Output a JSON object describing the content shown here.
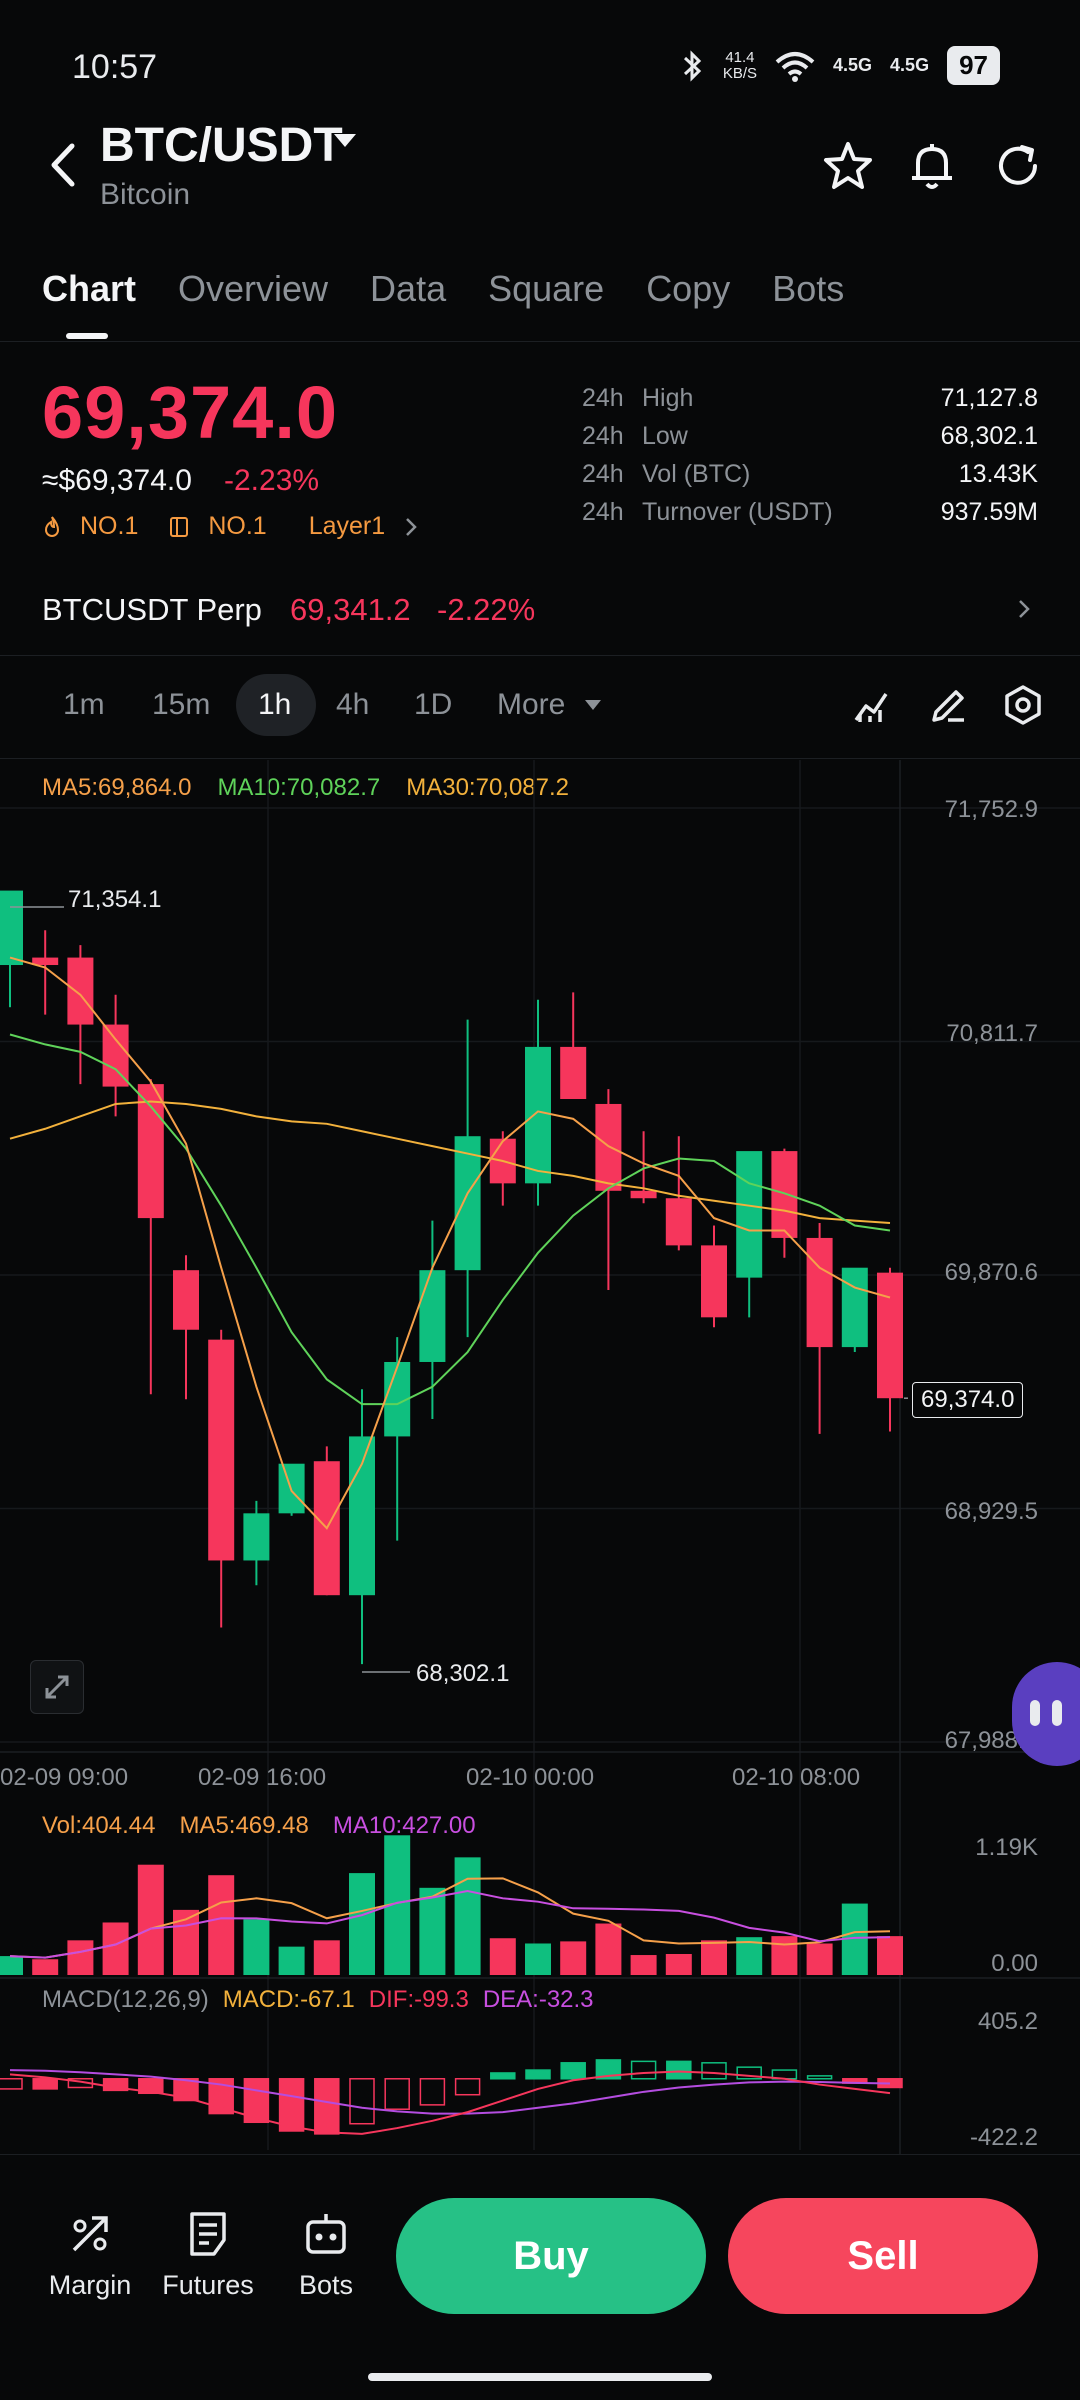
{
  "status_bar": {
    "time": "10:57",
    "net_speed": "41.4",
    "net_speed_unit": "KB/S",
    "sig1": "4.5G",
    "sig2": "4.5G",
    "battery": "97"
  },
  "header": {
    "pair": "BTC/USDT",
    "coin_name": "Bitcoin"
  },
  "tabs": [
    "Chart",
    "Overview",
    "Data",
    "Square",
    "Copy",
    "Bots"
  ],
  "price": {
    "last": "69,374.0",
    "fiat": "≈$69,374.0",
    "change": "-2.23%",
    "rank1": "NO.1",
    "rank2": "NO.1",
    "category": "Layer1"
  },
  "stats": [
    {
      "p": "24h",
      "label": "High",
      "value": "71,127.8"
    },
    {
      "p": "24h",
      "label": "Low",
      "value": "68,302.1"
    },
    {
      "p": "24h",
      "label": "Vol (BTC)",
      "value": "13.43K"
    },
    {
      "p": "24h",
      "label": "Turnover (USDT)",
      "value": "937.59M"
    }
  ],
  "perp": {
    "name": "BTCUSDT Perp",
    "price": "69,341.2",
    "change": "-2.22%"
  },
  "timeframes": [
    "1m",
    "15m",
    "1h",
    "4h",
    "1D",
    "More"
  ],
  "ma_legend": {
    "ma5": "MA5:69,864.0",
    "ma10": "MA10:70,082.7",
    "ma30": "MA30:70,087.2"
  },
  "colors": {
    "up": "#0fbf7f",
    "down": "#f6365c",
    "ma5": "#f5a04a",
    "ma10": "#5fd35a",
    "ma30": "#f2b13c",
    "macd_dif": "#f6365c",
    "macd_dea": "#b44de0"
  },
  "chart_data": {
    "type": "candlestick",
    "y_axis_ticks": [
      "71,752.9",
      "70,811.7",
      "69,870.6",
      "68,929.5",
      "67,988.3"
    ],
    "ylim": [
      67988.3,
      71752.9
    ],
    "x_axis_ticks": [
      "02-09 09:00",
      "02-09 16:00",
      "02-10 00:00",
      "02-10 08:00"
    ],
    "high_marker": "71,354.1",
    "low_marker": "68,302.1",
    "last_price_marker": "69,374.0",
    "candles": [
      {
        "o": 71120,
        "h": 71354.1,
        "l": 70950,
        "c": 71420
      },
      {
        "o": 71150,
        "h": 71260,
        "l": 70920,
        "c": 71120
      },
      {
        "o": 71150,
        "h": 71200,
        "l": 70640,
        "c": 70880
      },
      {
        "o": 70880,
        "h": 71000,
        "l": 70510,
        "c": 70630
      },
      {
        "o": 70640,
        "h": 70660,
        "l": 69390,
        "c": 70100
      },
      {
        "o": 69890,
        "h": 69950,
        "l": 69370,
        "c": 69650
      },
      {
        "o": 69610,
        "h": 69650,
        "l": 68450,
        "c": 68720
      },
      {
        "o": 68720,
        "h": 68960,
        "l": 68620,
        "c": 68910
      },
      {
        "o": 68910,
        "h": 69100,
        "l": 68900,
        "c": 69110
      },
      {
        "o": 69120,
        "h": 69180,
        "l": 68580,
        "c": 68580
      },
      {
        "o": 68580,
        "h": 69410,
        "l": 68302.1,
        "c": 69220
      },
      {
        "o": 69220,
        "h": 69620,
        "l": 68800,
        "c": 69520
      },
      {
        "o": 69520,
        "h": 70090,
        "l": 69290,
        "c": 69890
      },
      {
        "o": 69890,
        "h": 70900,
        "l": 69620,
        "c": 70430
      },
      {
        "o": 70420,
        "h": 70450,
        "l": 70150,
        "c": 70240
      },
      {
        "o": 70240,
        "h": 70980,
        "l": 70150,
        "c": 70790
      },
      {
        "o": 70790,
        "h": 71010,
        "l": 70580,
        "c": 70580
      },
      {
        "o": 70560,
        "h": 70620,
        "l": 69810,
        "c": 70210
      },
      {
        "o": 70210,
        "h": 70450,
        "l": 70160,
        "c": 70180
      },
      {
        "o": 70180,
        "h": 70430,
        "l": 69970,
        "c": 69990
      },
      {
        "o": 69990,
        "h": 70070,
        "l": 69660,
        "c": 69700
      },
      {
        "o": 69860,
        "h": 70360,
        "l": 69700,
        "c": 70370
      },
      {
        "o": 70370,
        "h": 70380,
        "l": 69940,
        "c": 70020
      },
      {
        "o": 70020,
        "h": 70080,
        "l": 69230,
        "c": 69580
      },
      {
        "o": 69580,
        "h": 69880,
        "l": 69560,
        "c": 69900
      },
      {
        "o": 69880,
        "h": 69900,
        "l": 69240,
        "c": 69374.0
      }
    ],
    "ma5": [
      71150,
      71110,
      71000,
      70820,
      70650,
      70400,
      69900,
      69420,
      69000,
      68850,
      69110,
      69500,
      69900,
      70200,
      70410,
      70530,
      70500,
      70390,
      70320,
      70270,
      70100,
      70050,
      70050,
      69900,
      69820,
      69780
    ],
    "ma10": [
      70840,
      70800,
      70770,
      70700,
      70550,
      70380,
      70150,
      69900,
      69640,
      69450,
      69350,
      69350,
      69420,
      69560,
      69770,
      69960,
      70110,
      70220,
      70300,
      70340,
      70330,
      70240,
      70200,
      70150,
      70070,
      70050
    ],
    "ma30": [
      70420,
      70460,
      70510,
      70560,
      70570,
      70560,
      70540,
      70510,
      70490,
      70480,
      70450,
      70420,
      70390,
      70360,
      70330,
      70290,
      70270,
      70240,
      70220,
      70190,
      70170,
      70150,
      70130,
      70100,
      70090,
      70080
    ],
    "volume": {
      "legend": {
        "vol": "Vol:404.44",
        "ma5": "MA5:469.48",
        "ma10": "MA10:427.00"
      },
      "axis_max": "1.19K",
      "axis_min": "0.00",
      "values": [
        180,
        150,
        330,
        500,
        1050,
        620,
        950,
        530,
        270,
        330,
        970,
        1330,
        830,
        1120,
        350,
        300,
        320,
        490,
        190,
        200,
        330,
        360,
        370,
        300,
        680,
        370
      ]
    },
    "macd": {
      "legend": {
        "name": "MACD(12,26,9)",
        "macd": "MACD:-67.1",
        "dif": "DIF:-99.3",
        "dea": "DEA:-32.3"
      },
      "axis_max": "405.2",
      "axis_min": "-422.2",
      "hist": [
        -70,
        -70,
        -60,
        -80,
        -100,
        -150,
        -240,
        -300,
        -360,
        -380,
        -310,
        -210,
        -180,
        -110,
        40,
        60,
        110,
        130,
        120,
        120,
        110,
        80,
        60,
        20,
        -30,
        -60
      ],
      "dif": [
        30,
        10,
        -20,
        -60,
        -90,
        -130,
        -200,
        -270,
        -330,
        -370,
        -380,
        -340,
        -290,
        -230,
        -150,
        -70,
        -10,
        20,
        40,
        50,
        40,
        20,
        0,
        -40,
        -70,
        -99.3
      ],
      "dea": [
        60,
        55,
        45,
        30,
        15,
        -10,
        -40,
        -80,
        -120,
        -160,
        -200,
        -225,
        -240,
        -240,
        -230,
        -200,
        -170,
        -130,
        -90,
        -60,
        -40,
        -25,
        -20,
        -22,
        -28,
        -32.3
      ]
    }
  },
  "bottom_nav": [
    {
      "icon": "margin-icon",
      "label": "Margin"
    },
    {
      "icon": "futures-icon",
      "label": "Futures"
    },
    {
      "icon": "bots-icon",
      "label": "Bots"
    }
  ],
  "actions": {
    "buy": "Buy",
    "sell": "Sell"
  }
}
